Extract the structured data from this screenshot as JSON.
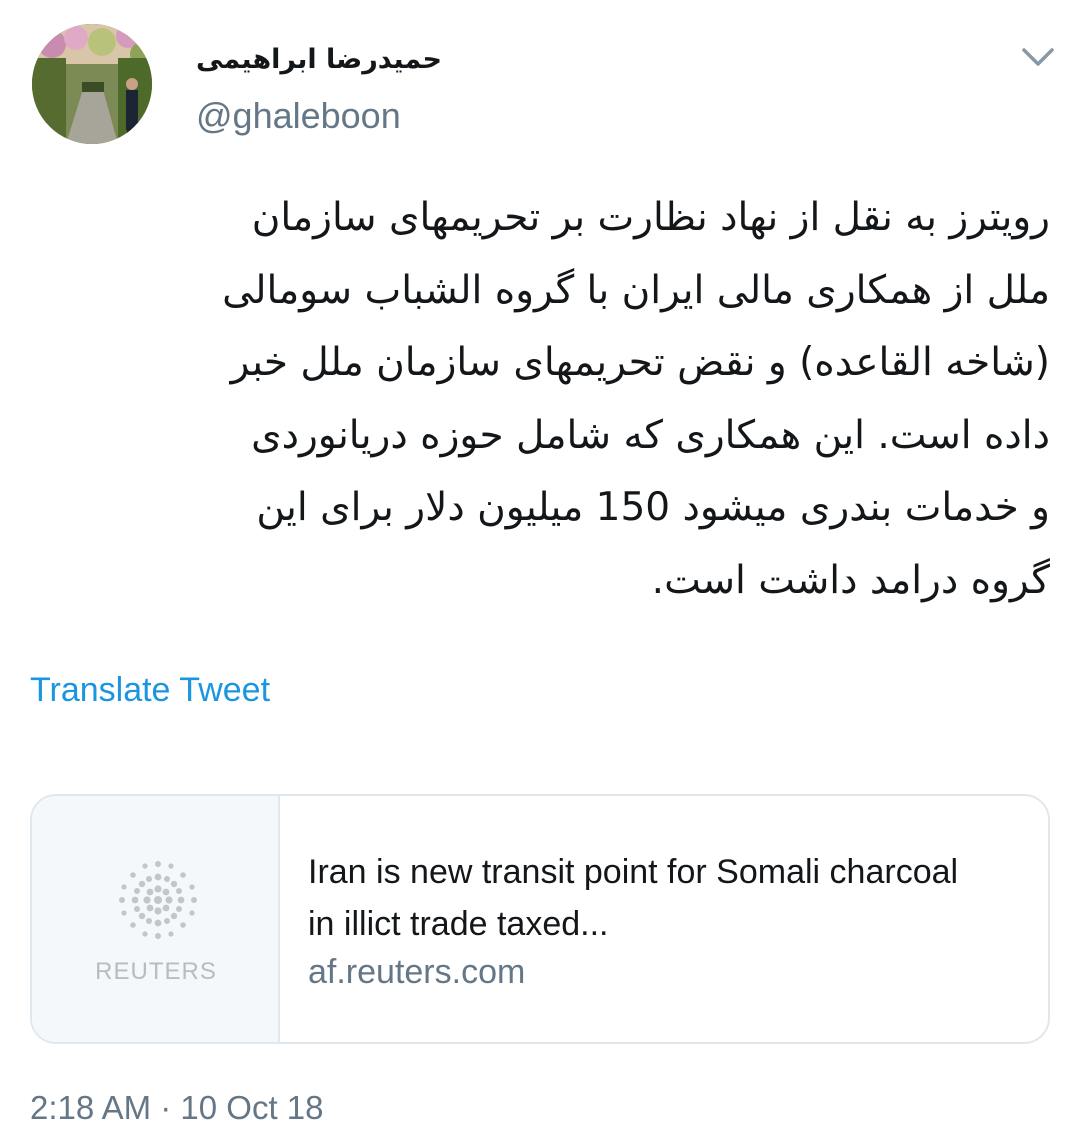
{
  "author": {
    "display_name": "حمیدرضا ابراهیمی",
    "username": "@ghaleboon"
  },
  "tweet": {
    "text_lines": [
      "رویترز به نقل از نهاد نظارت بر تحریمهای سازمان",
      "ملل از همکاری مالی ایران با  گروه الشباب سومالی",
      "(شاخه القاعده) و نقض تحریمهای سازمان ملل خبر",
      "داده است. این همکاری که شامل حوزه دریانوردی",
      "و خدمات بندری میشود 150 میلیون دلار برای این",
      "گروه درامد داشت است."
    ],
    "translate_label": "Translate Tweet",
    "timestamp": "2:18 AM · 10 Oct 18"
  },
  "card": {
    "thumbnail_wordmark": "REUTERS",
    "title_lines": [
      "Iran is new transit point for Somali charcoal",
      "in illict trade taxed..."
    ],
    "domain": "af.reuters.com"
  },
  "icons": {
    "menu": "chevron-down-icon",
    "thumbnail": "reuters-logo-icon",
    "avatar": "profile-photo"
  },
  "colors": {
    "link": "#1b95e0",
    "secondary_text": "#657786",
    "border": "#e1e8ed"
  }
}
